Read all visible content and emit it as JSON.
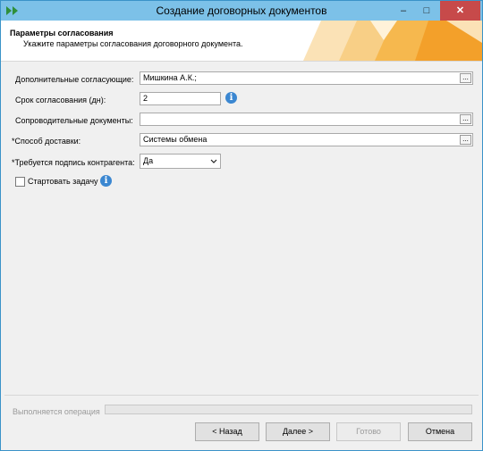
{
  "window": {
    "title": "Создание договорных документов",
    "controls": {
      "minimize": "–",
      "maximize": "□",
      "close": "✕"
    }
  },
  "header": {
    "title": "Параметры согласования",
    "subtitle": "Укажите параметры согласования договорного документа."
  },
  "form": {
    "approvers": {
      "label": "Дополнительные согласующие:",
      "value": "Мишкина А.К.;",
      "button": "..."
    },
    "term": {
      "label": "Срок согласования (дн):",
      "value": "2",
      "info": "i"
    },
    "documents": {
      "label": "Сопроводительные документы:",
      "value": "",
      "button": "..."
    },
    "delivery": {
      "label": "*Способ доставки:",
      "value": "Системы обмена",
      "button": "..."
    },
    "signature": {
      "label": "*Требуется подпись контрагента:",
      "value": "Да"
    },
    "start_task": {
      "label": "Стартовать задачу",
      "checked": false,
      "info": "i"
    }
  },
  "status": {
    "label": "Выполняется операция",
    "progress": 0
  },
  "buttons": {
    "back": "< Назад",
    "next": "Далее >",
    "done": "Готово",
    "cancel": "Отмена"
  },
  "colors": {
    "titlebar": "#7cc1e8",
    "accent": "#3b87d1",
    "banner": "#f6a834",
    "close": "#c74a4a"
  },
  "icons": {
    "app": "double-chevron-icon",
    "info": "info-icon"
  }
}
